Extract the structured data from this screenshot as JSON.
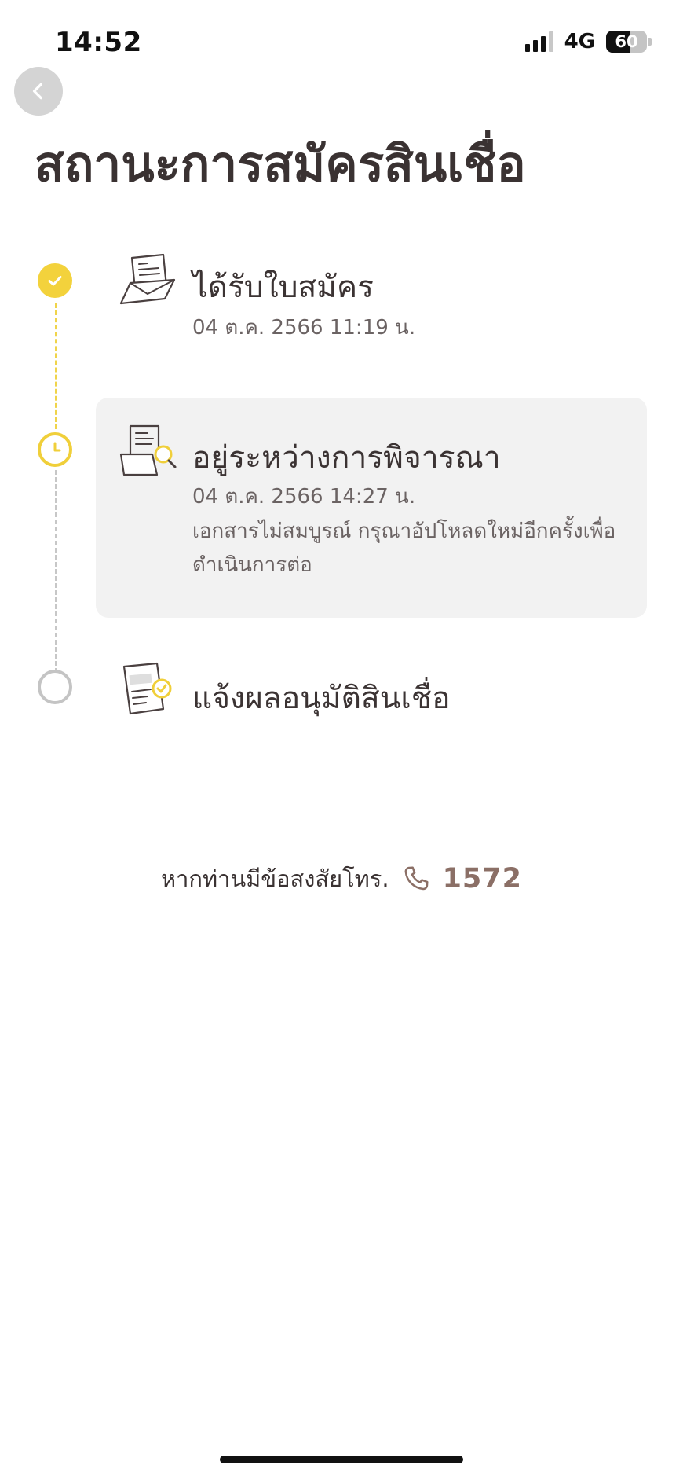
{
  "status_bar": {
    "time": "14:52",
    "network": "4G",
    "battery": "60",
    "battery_level_percent": 60
  },
  "header": {
    "title": "สถานะการสมัครสินเชื่อ"
  },
  "steps": [
    {
      "title": "ได้รับใบสมัคร",
      "timestamp": "04 ต.ค. 2566 11:19 น.",
      "state": "done",
      "icon": "application-form-icon"
    },
    {
      "title": "อยู่ระหว่างการพิจารณา",
      "timestamp": "04 ต.ค. 2566 14:27 น.",
      "note_line1": "เอกสารไม่สมบูรณ์ กรุณาอัปโหลดใหม่อีกครั้งเพื่อ",
      "note_line2": "ดำเนินการต่อ",
      "state": "current",
      "icon": "document-search-icon"
    },
    {
      "title": "แจ้งผลอนุมัติสินเชื่อ",
      "state": "pending",
      "icon": "approval-document-icon"
    }
  ],
  "help": {
    "text": "หากท่านมีข้อสงสัยโทร.",
    "phone": "1572",
    "icon": "phone-icon"
  },
  "colors": {
    "accent_yellow": "#f3d23c",
    "phone_brown": "#8b6f66",
    "card_background": "#f2f2f2",
    "pending_gray": "#c4c4c4"
  }
}
